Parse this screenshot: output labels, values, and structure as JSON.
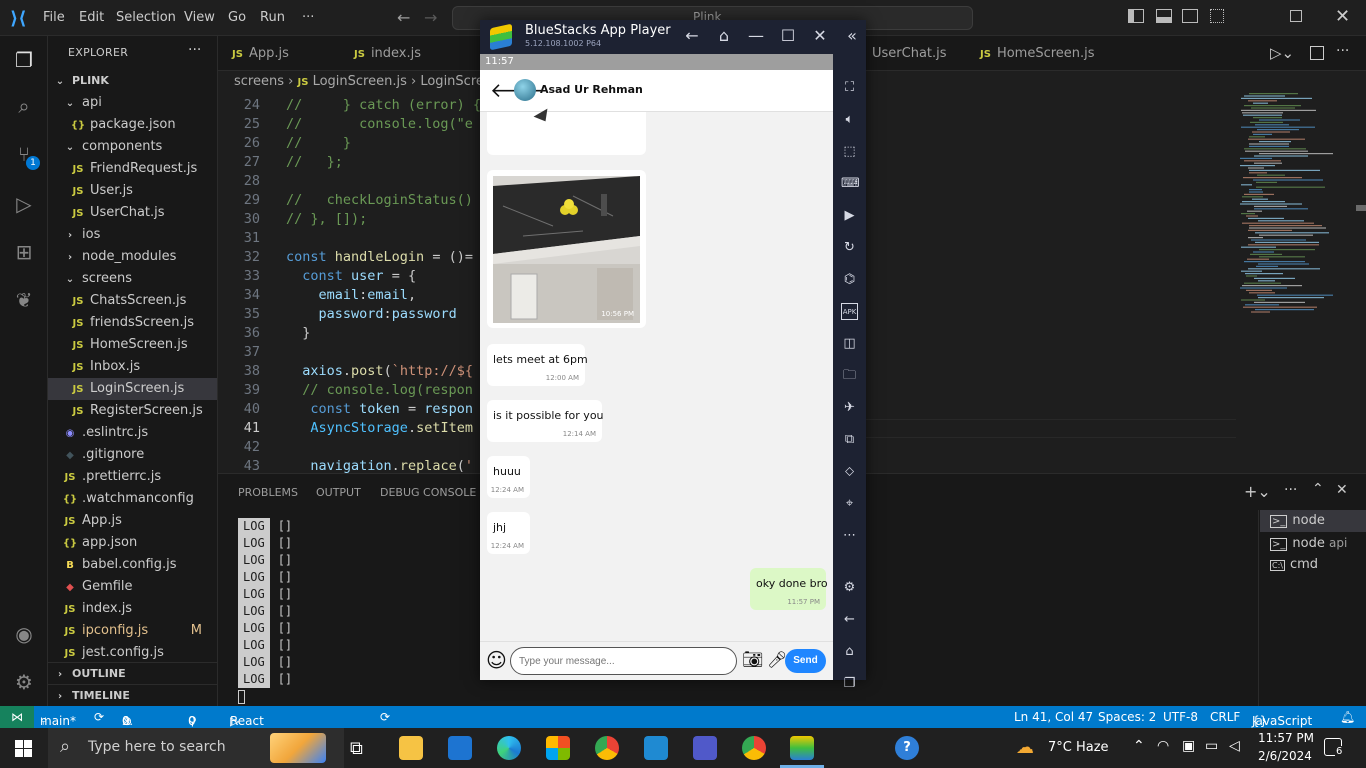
{
  "titlebar": {
    "menus": [
      "File",
      "Edit",
      "Selection",
      "View",
      "Go",
      "Run",
      "···"
    ],
    "search": "Plink"
  },
  "explorer": {
    "title": "EXPLORER",
    "root": "PLINK",
    "items": [
      {
        "label": "api",
        "kind": "folder",
        "depth": 1
      },
      {
        "label": "package.json",
        "kind": "json",
        "depth": 2
      },
      {
        "label": "components",
        "kind": "folder",
        "depth": 1
      },
      {
        "label": "FriendRequest.js",
        "kind": "js",
        "depth": 2
      },
      {
        "label": "User.js",
        "kind": "js",
        "depth": 2
      },
      {
        "label": "UserChat.js",
        "kind": "js",
        "depth": 2
      },
      {
        "label": "ios",
        "kind": "folder-closed",
        "depth": 1
      },
      {
        "label": "node_modules",
        "kind": "folder-closed",
        "depth": 1
      },
      {
        "label": "screens",
        "kind": "folder",
        "depth": 1
      },
      {
        "label": "ChatsScreen.js",
        "kind": "js",
        "depth": 2
      },
      {
        "label": "friendsScreen.js",
        "kind": "js",
        "depth": 2
      },
      {
        "label": "HomeScreen.js",
        "kind": "js",
        "depth": 2
      },
      {
        "label": "Inbox.js",
        "kind": "js",
        "depth": 2
      },
      {
        "label": "LoginScreen.js",
        "kind": "js",
        "depth": 2,
        "selected": true
      },
      {
        "label": "RegisterScreen.js",
        "kind": "js",
        "depth": 2
      },
      {
        "label": ".eslintrc.js",
        "kind": "eslint",
        "depth": 1
      },
      {
        "label": ".gitignore",
        "kind": "git",
        "depth": 1
      },
      {
        "label": ".prettierrc.js",
        "kind": "js",
        "depth": 1
      },
      {
        "label": ".watchmanconfig",
        "kind": "json",
        "depth": 1
      },
      {
        "label": "App.js",
        "kind": "js",
        "depth": 1
      },
      {
        "label": "app.json",
        "kind": "json",
        "depth": 1
      },
      {
        "label": "babel.config.js",
        "kind": "babel",
        "depth": 1
      },
      {
        "label": "Gemfile",
        "kind": "gem",
        "depth": 1
      },
      {
        "label": "index.js",
        "kind": "js",
        "depth": 1
      },
      {
        "label": "ipconfig.js",
        "kind": "js",
        "depth": 1,
        "badge": "M"
      },
      {
        "label": "jest.config.js",
        "kind": "js",
        "depth": 1
      }
    ],
    "outline": "OUTLINE",
    "timeline": "TIMELINE"
  },
  "tabs": [
    "App.js",
    "index.js",
    "UserChat.js",
    "HomeScreen.js"
  ],
  "breadcrumb": [
    "screens",
    "LoginScreen.js",
    "LoginScre"
  ],
  "code": [
    {
      "n": "24",
      "t": "//     } catch (error) {"
    },
    {
      "n": "25",
      "t": "//       console.log(\"e"
    },
    {
      "n": "26",
      "t": "//     }"
    },
    {
      "n": "27",
      "t": "//   };"
    },
    {
      "n": "28",
      "t": ""
    },
    {
      "n": "29",
      "t": "//   checkLoginStatus()"
    },
    {
      "n": "30",
      "t": "// }, []);"
    },
    {
      "n": "31",
      "t": ""
    },
    {
      "n": "32",
      "t": "const handleLogin = ()="
    },
    {
      "n": "33",
      "t": "  const user = {"
    },
    {
      "n": "34",
      "t": "    email:email,"
    },
    {
      "n": "35",
      "t": "    password:password"
    },
    {
      "n": "36",
      "t": "  }"
    },
    {
      "n": "37",
      "t": ""
    },
    {
      "n": "38",
      "t": "  axios.post(`http://${"
    },
    {
      "n": "39",
      "t": "  // console.log(respon"
    },
    {
      "n": "40",
      "t": "   const token = respon"
    },
    {
      "n": "41",
      "t": "   AsyncStorage.setItem"
    },
    {
      "n": "42",
      "t": ""
    },
    {
      "n": "43",
      "t": "   navigation.replace('"
    }
  ],
  "panel": {
    "tabs": [
      "PROBLEMS",
      "OUTPUT",
      "DEBUG CONSOLE"
    ],
    "log_tag": "LOG",
    "log_value": "[]",
    "log_count": 10,
    "terminals": [
      {
        "label": "node",
        "selected": true
      },
      {
        "label": "node",
        "sub": "api"
      },
      {
        "label": "cmd"
      }
    ]
  },
  "statusbar": {
    "branch": "main*",
    "errors": "0",
    "warnings": "0",
    "ports": "0",
    "packager": "React Native Packager",
    "position": "Ln 41, Col 47",
    "spaces": "Spaces: 2",
    "encoding": "UTF-8",
    "eol": "CRLF",
    "language": "JavaScript"
  },
  "bluestacks": {
    "title": "BlueStacks App Player",
    "version": "5.12.108.1002  P64",
    "phone_time": "11:57",
    "contact": "Asad Ur Rehman",
    "image_time": "10:56 PM",
    "messages": [
      {
        "text": "lets meet at 6pm",
        "time": "12:00 AM",
        "mine": false
      },
      {
        "text": "is it possible for you",
        "time": "12:14 AM",
        "mine": false
      },
      {
        "text": "huuu",
        "time": "12:24 AM",
        "mine": false
      },
      {
        "text": "jhj",
        "time": "12:24 AM",
        "mine": false
      },
      {
        "text": "oky done bro",
        "time": "11:57 PM",
        "mine": true
      }
    ],
    "input_placeholder": "Type your message...",
    "send_label": "Send"
  },
  "taskbar": {
    "search_placeholder": "Type here to search",
    "weather": "7°C  Haze",
    "time": "11:57 PM",
    "date": "2/6/2024",
    "notifications": "6"
  },
  "colors": {
    "statusbar": "#007acc",
    "send": "#1f86ff",
    "my_bubble": "#dcf8c6"
  }
}
